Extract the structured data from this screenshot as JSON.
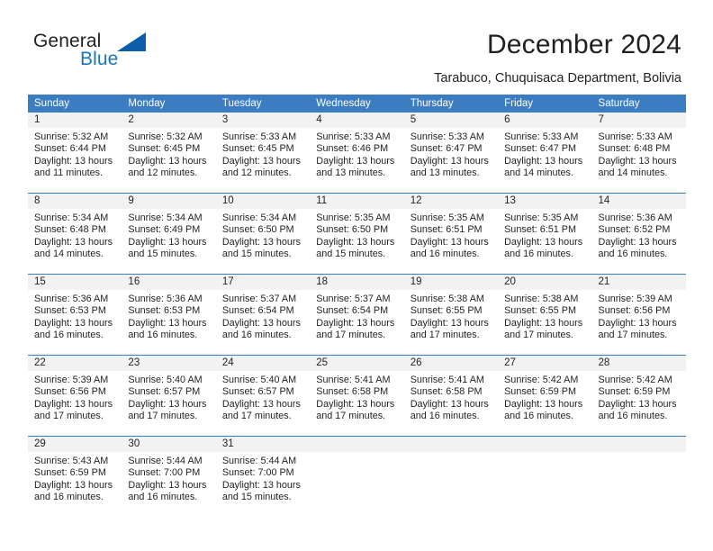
{
  "brand": {
    "name_part1": "General",
    "name_part2": "Blue",
    "triangle_icon": "triangle-logo-icon",
    "accent_color": "#1b75bc",
    "triangle_color": "#0b5ea8"
  },
  "header": {
    "title": "December 2024",
    "subtitle": "Tarabuco, Chuquisaca Department, Bolivia"
  },
  "calendar": {
    "header_bg": "#3b7dc0",
    "daynum_bg": "#f2f2f2",
    "weekdays": [
      "Sunday",
      "Monday",
      "Tuesday",
      "Wednesday",
      "Thursday",
      "Friday",
      "Saturday"
    ],
    "weeks": [
      [
        {
          "day": "1",
          "lines": [
            "Sunrise: 5:32 AM",
            "Sunset: 6:44 PM",
            "Daylight: 13 hours",
            "and 11 minutes."
          ]
        },
        {
          "day": "2",
          "lines": [
            "Sunrise: 5:32 AM",
            "Sunset: 6:45 PM",
            "Daylight: 13 hours",
            "and 12 minutes."
          ]
        },
        {
          "day": "3",
          "lines": [
            "Sunrise: 5:33 AM",
            "Sunset: 6:45 PM",
            "Daylight: 13 hours",
            "and 12 minutes."
          ]
        },
        {
          "day": "4",
          "lines": [
            "Sunrise: 5:33 AM",
            "Sunset: 6:46 PM",
            "Daylight: 13 hours",
            "and 13 minutes."
          ]
        },
        {
          "day": "5",
          "lines": [
            "Sunrise: 5:33 AM",
            "Sunset: 6:47 PM",
            "Daylight: 13 hours",
            "and 13 minutes."
          ]
        },
        {
          "day": "6",
          "lines": [
            "Sunrise: 5:33 AM",
            "Sunset: 6:47 PM",
            "Daylight: 13 hours",
            "and 14 minutes."
          ]
        },
        {
          "day": "7",
          "lines": [
            "Sunrise: 5:33 AM",
            "Sunset: 6:48 PM",
            "Daylight: 13 hours",
            "and 14 minutes."
          ]
        }
      ],
      [
        {
          "day": "8",
          "lines": [
            "Sunrise: 5:34 AM",
            "Sunset: 6:48 PM",
            "Daylight: 13 hours",
            "and 14 minutes."
          ]
        },
        {
          "day": "9",
          "lines": [
            "Sunrise: 5:34 AM",
            "Sunset: 6:49 PM",
            "Daylight: 13 hours",
            "and 15 minutes."
          ]
        },
        {
          "day": "10",
          "lines": [
            "Sunrise: 5:34 AM",
            "Sunset: 6:50 PM",
            "Daylight: 13 hours",
            "and 15 minutes."
          ]
        },
        {
          "day": "11",
          "lines": [
            "Sunrise: 5:35 AM",
            "Sunset: 6:50 PM",
            "Daylight: 13 hours",
            "and 15 minutes."
          ]
        },
        {
          "day": "12",
          "lines": [
            "Sunrise: 5:35 AM",
            "Sunset: 6:51 PM",
            "Daylight: 13 hours",
            "and 16 minutes."
          ]
        },
        {
          "day": "13",
          "lines": [
            "Sunrise: 5:35 AM",
            "Sunset: 6:51 PM",
            "Daylight: 13 hours",
            "and 16 minutes."
          ]
        },
        {
          "day": "14",
          "lines": [
            "Sunrise: 5:36 AM",
            "Sunset: 6:52 PM",
            "Daylight: 13 hours",
            "and 16 minutes."
          ]
        }
      ],
      [
        {
          "day": "15",
          "lines": [
            "Sunrise: 5:36 AM",
            "Sunset: 6:53 PM",
            "Daylight: 13 hours",
            "and 16 minutes."
          ]
        },
        {
          "day": "16",
          "lines": [
            "Sunrise: 5:36 AM",
            "Sunset: 6:53 PM",
            "Daylight: 13 hours",
            "and 16 minutes."
          ]
        },
        {
          "day": "17",
          "lines": [
            "Sunrise: 5:37 AM",
            "Sunset: 6:54 PM",
            "Daylight: 13 hours",
            "and 16 minutes."
          ]
        },
        {
          "day": "18",
          "lines": [
            "Sunrise: 5:37 AM",
            "Sunset: 6:54 PM",
            "Daylight: 13 hours",
            "and 17 minutes."
          ]
        },
        {
          "day": "19",
          "lines": [
            "Sunrise: 5:38 AM",
            "Sunset: 6:55 PM",
            "Daylight: 13 hours",
            "and 17 minutes."
          ]
        },
        {
          "day": "20",
          "lines": [
            "Sunrise: 5:38 AM",
            "Sunset: 6:55 PM",
            "Daylight: 13 hours",
            "and 17 minutes."
          ]
        },
        {
          "day": "21",
          "lines": [
            "Sunrise: 5:39 AM",
            "Sunset: 6:56 PM",
            "Daylight: 13 hours",
            "and 17 minutes."
          ]
        }
      ],
      [
        {
          "day": "22",
          "lines": [
            "Sunrise: 5:39 AM",
            "Sunset: 6:56 PM",
            "Daylight: 13 hours",
            "and 17 minutes."
          ]
        },
        {
          "day": "23",
          "lines": [
            "Sunrise: 5:40 AM",
            "Sunset: 6:57 PM",
            "Daylight: 13 hours",
            "and 17 minutes."
          ]
        },
        {
          "day": "24",
          "lines": [
            "Sunrise: 5:40 AM",
            "Sunset: 6:57 PM",
            "Daylight: 13 hours",
            "and 17 minutes."
          ]
        },
        {
          "day": "25",
          "lines": [
            "Sunrise: 5:41 AM",
            "Sunset: 6:58 PM",
            "Daylight: 13 hours",
            "and 17 minutes."
          ]
        },
        {
          "day": "26",
          "lines": [
            "Sunrise: 5:41 AM",
            "Sunset: 6:58 PM",
            "Daylight: 13 hours",
            "and 16 minutes."
          ]
        },
        {
          "day": "27",
          "lines": [
            "Sunrise: 5:42 AM",
            "Sunset: 6:59 PM",
            "Daylight: 13 hours",
            "and 16 minutes."
          ]
        },
        {
          "day": "28",
          "lines": [
            "Sunrise: 5:42 AM",
            "Sunset: 6:59 PM",
            "Daylight: 13 hours",
            "and 16 minutes."
          ]
        }
      ],
      [
        {
          "day": "29",
          "lines": [
            "Sunrise: 5:43 AM",
            "Sunset: 6:59 PM",
            "Daylight: 13 hours",
            "and 16 minutes."
          ]
        },
        {
          "day": "30",
          "lines": [
            "Sunrise: 5:44 AM",
            "Sunset: 7:00 PM",
            "Daylight: 13 hours",
            "and 16 minutes."
          ]
        },
        {
          "day": "31",
          "lines": [
            "Sunrise: 5:44 AM",
            "Sunset: 7:00 PM",
            "Daylight: 13 hours",
            "and 15 minutes."
          ]
        },
        {
          "day": "",
          "lines": []
        },
        {
          "day": "",
          "lines": []
        },
        {
          "day": "",
          "lines": []
        },
        {
          "day": "",
          "lines": []
        }
      ]
    ]
  }
}
